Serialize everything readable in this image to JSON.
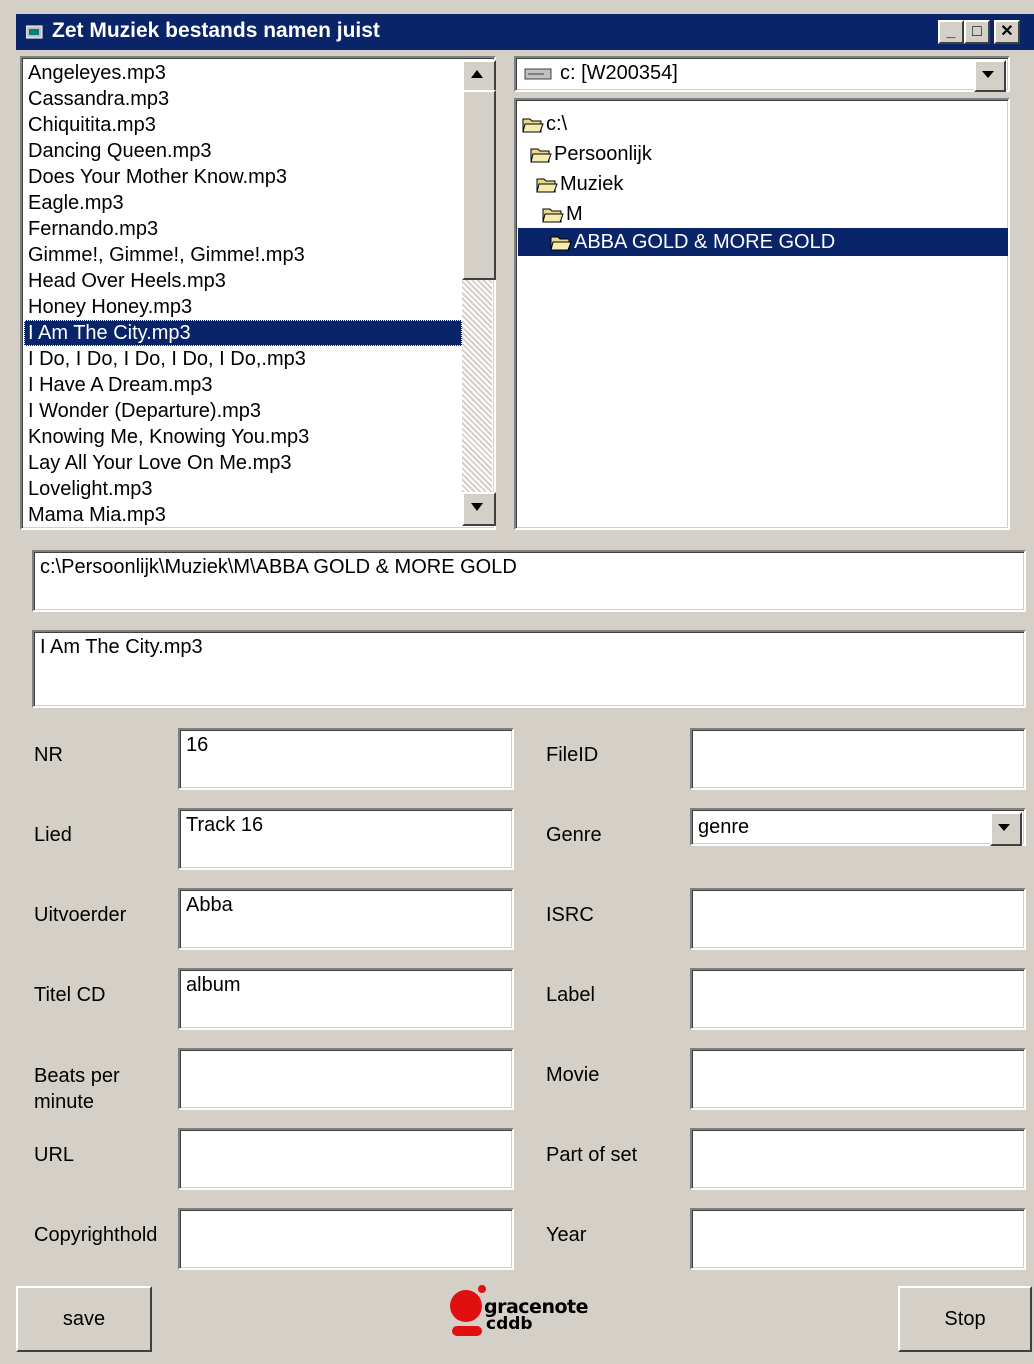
{
  "window": {
    "title": "Zet Muziek bestands namen juist",
    "minimize": "_",
    "maximize": "□",
    "close": "✕"
  },
  "file_list": {
    "items": [
      "Angeleyes.mp3",
      "Cassandra.mp3",
      "Chiquitita.mp3",
      "Dancing Queen.mp3",
      "Does Your Mother Know.mp3",
      "Eagle.mp3",
      "Fernando.mp3",
      "Gimme!, Gimme!, Gimme!.mp3",
      "Head Over Heels.mp3",
      "Honey Honey.mp3",
      "I Am The City.mp3",
      "I Do, I Do, I Do, I Do, I Do,.mp3",
      "I Have A Dream.mp3",
      "I Wonder (Departure).mp3",
      "Knowing Me, Knowing You.mp3",
      "Lay All Your Love On Me.mp3",
      "Lovelight.mp3",
      "Mama Mia.mp3"
    ],
    "selected": "I Am The City.mp3"
  },
  "drive": {
    "value": "c: [W200354]"
  },
  "tree": {
    "nodes": [
      "c:\\",
      "Persoonlijk",
      "Muziek",
      "M",
      "ABBA GOLD & MORE GOLD"
    ],
    "selected": "ABBA GOLD & MORE GOLD"
  },
  "path_box": "c:\\Persoonlijk\\Muziek\\M\\ABBA GOLD & MORE GOLD",
  "filename_box": "I Am The City.mp3",
  "fields_left": {
    "nr": {
      "label": "NR",
      "value": "16"
    },
    "lied": {
      "label": "Lied",
      "value": "Track 16"
    },
    "uitvoerder": {
      "label": "Uitvoerder",
      "value": "Abba"
    },
    "titel_cd": {
      "label": "Titel CD",
      "value": "album"
    },
    "bpm": {
      "label": "Beats per minute",
      "value": ""
    },
    "url": {
      "label": "URL",
      "value": ""
    },
    "copyright": {
      "label": "Copyrighthold",
      "value": ""
    }
  },
  "fields_right": {
    "fileid": {
      "label": "FileID",
      "value": ""
    },
    "genre": {
      "label": "Genre",
      "value": "genre"
    },
    "isrc": {
      "label": "ISRC",
      "value": ""
    },
    "label": {
      "label": "Label",
      "value": ""
    },
    "movie": {
      "label": "Movie",
      "value": ""
    },
    "part_of_set": {
      "label": "Part of set",
      "value": ""
    },
    "year": {
      "label": "Year",
      "value": ""
    }
  },
  "buttons": {
    "save": "save",
    "stop": "Stop"
  },
  "logo": {
    "line1": "gracenote",
    "line2": "cddb"
  },
  "colors": {
    "face": "#d4d0c8",
    "title": "#0a246a",
    "selection": "#0a246a",
    "logo_red": "#e01010"
  }
}
